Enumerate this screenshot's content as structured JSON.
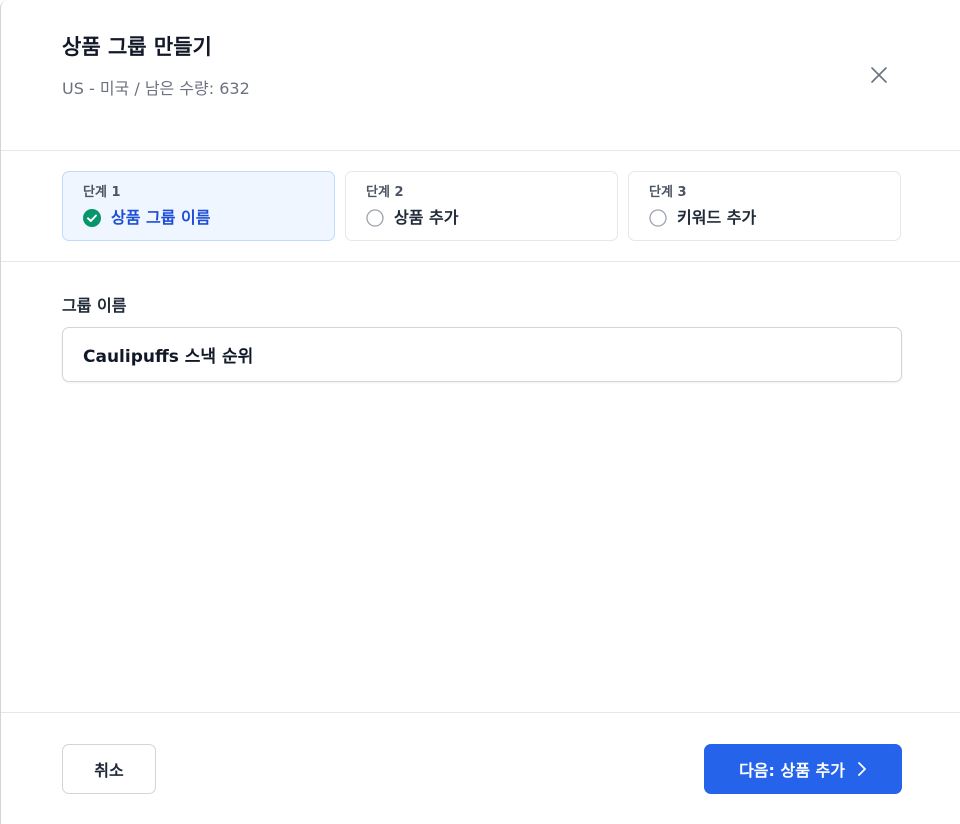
{
  "dialog": {
    "title": "상품 그룹 만들기",
    "subtitle": "US - 미국 / 남은 수량: 632",
    "close_icon": "close-icon"
  },
  "steps": [
    {
      "number": "단계 1",
      "label": "상품 그룹 이름",
      "status": "complete",
      "icon": "check-circle-icon"
    },
    {
      "number": "단계 2",
      "label": "상품 추가",
      "status": "pending",
      "icon": "empty-circle-icon"
    },
    {
      "number": "단계 3",
      "label": "키워드 추가",
      "status": "pending",
      "icon": "empty-circle-icon"
    }
  ],
  "form": {
    "group_name_label": "그룹 이름",
    "group_name_value": "Caulipuffs 스낵 순위"
  },
  "footer": {
    "cancel_label": "취소",
    "next_label": "다음: 상품 추가",
    "next_icon": "chevron-right-icon"
  },
  "colors": {
    "primary": "#2563eb",
    "active_step_bg": "#eff6ff",
    "complete_check": "#059669",
    "active_step_text": "#1d4ed8"
  }
}
